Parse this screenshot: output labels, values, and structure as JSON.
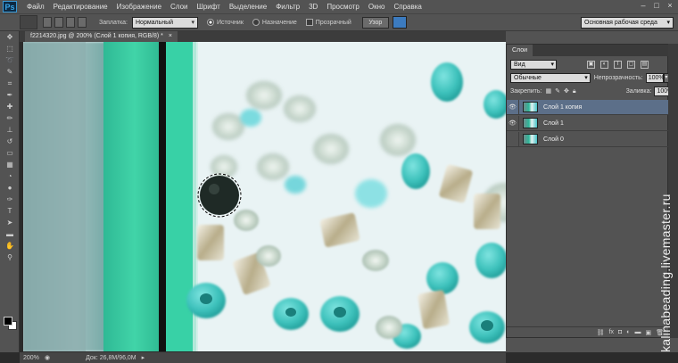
{
  "app": {
    "logo": "Ps"
  },
  "menu": [
    "Файл",
    "Редактирование",
    "Изображение",
    "Слои",
    "Шрифт",
    "Выделение",
    "Фильтр",
    "3D",
    "Просмотр",
    "Окно",
    "Справка"
  ],
  "options": {
    "patch_label": "Заплатка:",
    "patch_mode": "Нормальный",
    "source_label": "Источник",
    "dest_label": "Назначение",
    "transparent_label": "Прозрачный",
    "pattern_button": "Узор",
    "workspace": "Основная рабочая среда"
  },
  "document": {
    "tab_title": "f2214320.jpg @ 200% (Слой 1 копия, RGB/8) *",
    "zoom": "200%",
    "doc_info": "Док: 26,8M/96,0M"
  },
  "layers_panel": {
    "tab": "Слои",
    "kind_filter": "Вид",
    "blend_mode": "Обычные",
    "opacity_label": "Непрозрачность:",
    "opacity_value": "100%",
    "lock_label": "Закрепить:",
    "fill_label": "Заливка:",
    "fill_value": "100%",
    "layers": [
      {
        "name": "Слой 1 копия",
        "visible": true,
        "active": true
      },
      {
        "name": "Слой 1",
        "visible": true,
        "active": false
      },
      {
        "name": "Слой 0",
        "visible": false,
        "active": false
      }
    ]
  },
  "watermark": "kalinabeading.livemaster.ru",
  "colors": {
    "accent": "#5c6f89",
    "teal": "#35c1b8"
  }
}
